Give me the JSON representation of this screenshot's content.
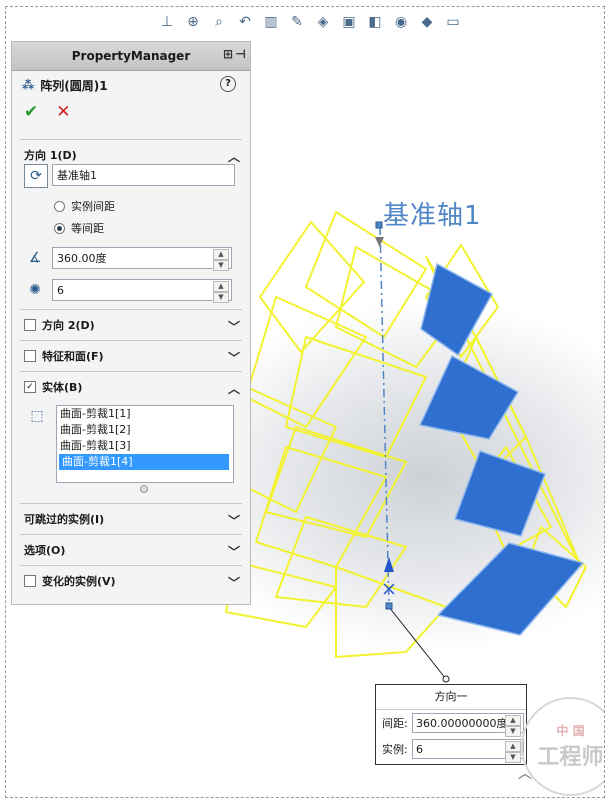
{
  "property_manager": {
    "title": "PropertyManager",
    "feature_name": "阵列(圆周)1",
    "ok_symbol": "✔",
    "cancel_symbol": "✕",
    "direction1": {
      "header": "方向 1(D)",
      "axis_value": "基准轴1",
      "radio_instance_spacing": "实例间距",
      "radio_equal_spacing": "等间距",
      "angle_value": "360.00度",
      "instances_value": "6"
    },
    "direction2": {
      "header": "方向 2(D)"
    },
    "features_faces": {
      "header": "特征和面(F)"
    },
    "bodies": {
      "header": "实体(B)",
      "items": [
        "曲面-剪裁1[1]",
        "曲面-剪裁1[2]",
        "曲面-剪裁1[3]",
        "曲面-剪裁1[4]"
      ],
      "selected_index": 3
    },
    "skip_instances": {
      "header": "可跳过的实例(I)"
    },
    "options": {
      "header": "选项(O)"
    },
    "vary_instances": {
      "header": "变化的实例(V)"
    }
  },
  "viewport": {
    "axis_label": "基准轴1",
    "dimension_box": {
      "title": "方向一",
      "spacing_label": "间距:",
      "spacing_value": "360.00000000度",
      "instances_label": "实例:",
      "instances_value": "6"
    },
    "watermark": {
      "top": "中 国",
      "bottom": "工程师"
    }
  },
  "colors": {
    "wireframe": "#f2f230",
    "faces": "#2f6fd0",
    "axis": "#4f86c6",
    "annotation_circle": "#d42020"
  }
}
